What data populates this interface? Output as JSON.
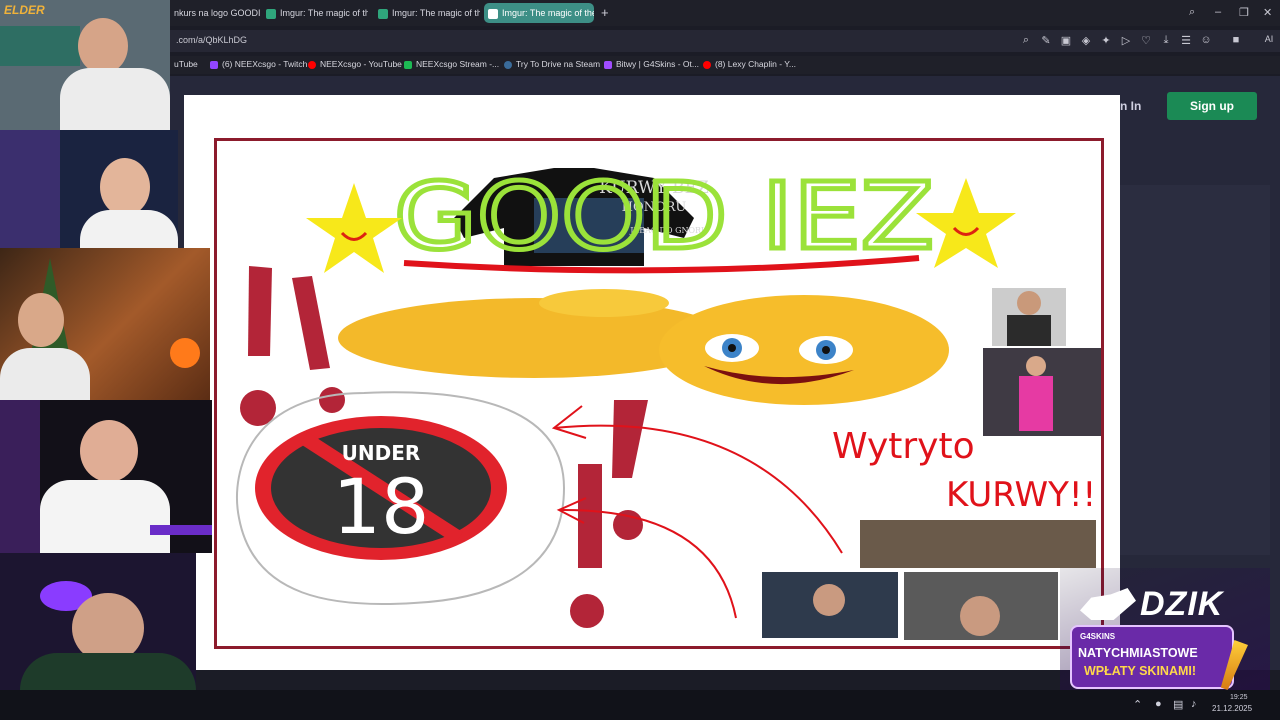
{
  "browser": {
    "tabs": [
      {
        "label": "nkurs na logo GOODIE...",
        "active": false
      },
      {
        "label": "Imgur: The magic of the I",
        "active": false
      },
      {
        "label": "Imgur: The magic of the I",
        "active": false
      },
      {
        "label": "Imgur: The magic of the I",
        "active": true
      }
    ],
    "new_tab_symbol": "+",
    "url": ".com/a/QbKLhDG",
    "bookmarks": [
      {
        "label": "uTube",
        "color": "#ff0000"
      },
      {
        "label": "(6) NEEXcsgo - Twitch",
        "color": "#9146ff"
      },
      {
        "label": "NEEXcsgo - YouTube",
        "color": "#ff0000"
      },
      {
        "label": "NEEXcsgo Stream -...",
        "color": "#1db954"
      },
      {
        "label": "Try To Drive na Steam",
        "color": "#1b2838"
      },
      {
        "label": "Bitwy | G4Skins - Ot...",
        "color": "#a04cff"
      },
      {
        "label": "(8) Lexy Chaplin - Y...",
        "color": "#ff0000"
      }
    ]
  },
  "site": {
    "signin_label": "n In",
    "signup_label": "Sign up"
  },
  "drawing": {
    "title_text": "GOOD IEZ",
    "shirt_line1": "KURWY BEZ",
    "shirt_line2": "HONORU",
    "shirt_line3": "JEBAC DO GNORU",
    "under_label": "UNDER",
    "age": "18",
    "caption_line1": "Wytryto",
    "caption_line2": "KURWY!!"
  },
  "overlay": {
    "channel_tag": "ELDER",
    "dzik": "DZIK",
    "promo_brand": "G4SKINS",
    "promo_line1": "NATYCHMIASTOWE",
    "promo_line2": "WPŁATY SKINAMI!"
  },
  "taskbar": {
    "time": "19:25",
    "date": "21.12.2025"
  }
}
